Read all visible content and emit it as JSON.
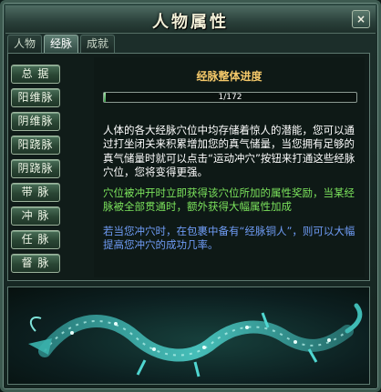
{
  "window": {
    "title": "人物属性",
    "close_label": "×"
  },
  "tabs": [
    {
      "label": "人物",
      "active": false
    },
    {
      "label": "经脉",
      "active": true
    },
    {
      "label": "成就",
      "active": false
    }
  ],
  "sidebar": {
    "items": [
      {
        "label": "总  据"
      },
      {
        "label": "阳维脉"
      },
      {
        "label": "阴维脉"
      },
      {
        "label": "阳跷脉"
      },
      {
        "label": "阴跷脉"
      },
      {
        "label": "带  脉"
      },
      {
        "label": "冲  脉"
      },
      {
        "label": "任  脉"
      },
      {
        "label": "督  脉"
      }
    ]
  },
  "progress": {
    "title": "经脉整体进度",
    "text": "1/172",
    "current": 1,
    "total": 172
  },
  "paragraphs": {
    "intro": "人体的各大经脉穴位中均存储着惊人的潜能，您可以通过打坐闭关来积累增加您的真气储量，当您拥有足够的真气储量时就可以点击“运动冲穴”按钮来打通这些经脉穴位，您将变得更强。",
    "reward": "穴位被冲开时立即获得该穴位所加的属性奖励，当某经脉被全部贯通时，额外获得大幅属性加成",
    "tip": "若当您冲穴时，在包裹中备有“经脉铜人”，则可以大幅提高您冲穴的成功几率。"
  },
  "colors": {
    "progress_title": "#f5c96a",
    "reward_text": "#7be25c",
    "tip_text": "#6f9cf5",
    "dragon_glow": "#4fd6d0"
  },
  "decor": {
    "image_icon": "dragon-illustration"
  }
}
